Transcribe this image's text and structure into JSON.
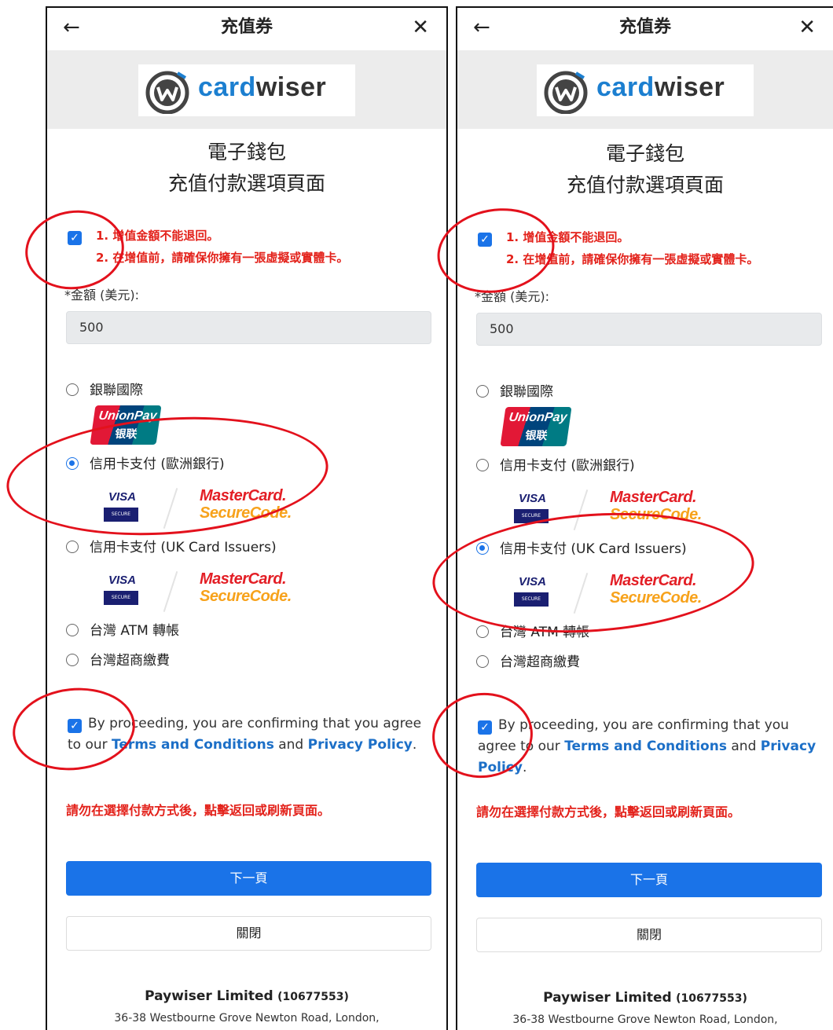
{
  "panels": [
    {
      "header": {
        "title": "充值券",
        "back_icon": "←",
        "close_icon": "✕"
      },
      "brand": {
        "word_part1": "card",
        "word_part2": "wiser"
      },
      "heading": {
        "line1": "電子錢包",
        "line2": "充值付款選項頁面"
      },
      "warnings": {
        "line1": "1. 增值金額不能退回。",
        "line2": "2. 在增值前，請確保你擁有一張虛擬或實體卡。",
        "checked": true
      },
      "amount": {
        "label": "*金額 (美元):",
        "value": "500"
      },
      "payment_options": [
        {
          "label": "銀聯國際",
          "logo": "unionpay",
          "selected": false
        },
        {
          "label": "信用卡支付 (歐洲銀行)",
          "logo": "visa-mastercard",
          "selected": true
        },
        {
          "label": "信用卡支付 (UK Card Issuers)",
          "logo": "visa-mastercard",
          "selected": false
        },
        {
          "label": "台灣 ATM 轉帳",
          "selected": false
        },
        {
          "label": "台灣超商繳費",
          "selected": false
        }
      ],
      "agreement": {
        "checked": true,
        "prefix": "By proceeding, you are confirming that you agree to our ",
        "terms": "Terms and Conditions",
        "and": " and ",
        "privacy": "Privacy Policy",
        "suffix": "."
      },
      "notice": "請勿在選擇付款方式後，點擊返回或刷新頁面。",
      "buttons": {
        "next": "下一頁",
        "close": "關閉"
      },
      "footer": {
        "company": "Paywiser Limited",
        "company_no": "(10677553)",
        "address": "36-38 Westbourne Grove Newton Road, London,"
      }
    },
    {
      "header": {
        "title": "充值券",
        "back_icon": "←",
        "close_icon": "✕"
      },
      "brand": {
        "word_part1": "card",
        "word_part2": "wiser"
      },
      "heading": {
        "line1": "電子錢包",
        "line2": "充值付款選項頁面"
      },
      "warnings": {
        "line1": "1. 增值金額不能退回。",
        "line2": "2. 在增值前，請確保你擁有一張虛擬或實體卡。",
        "checked": true
      },
      "amount": {
        "label": "*金額 (美元):",
        "value": "500"
      },
      "payment_options": [
        {
          "label": "銀聯國際",
          "logo": "unionpay",
          "selected": false
        },
        {
          "label": "信用卡支付 (歐洲銀行)",
          "logo": "visa-mastercard",
          "selected": false
        },
        {
          "label": "信用卡支付 (UK Card Issuers)",
          "logo": "visa-mastercard",
          "selected": true
        },
        {
          "label": "台灣 ATM 轉帳",
          "selected": false
        },
        {
          "label": "台灣超商繳費",
          "selected": false
        }
      ],
      "agreement": {
        "checked": true,
        "prefix": "By proceeding, you are confirming that you agree to our ",
        "terms": "Terms and Conditions",
        "and": " and ",
        "privacy": "Privacy Policy",
        "suffix": "."
      },
      "notice": "請勿在選擇付款方式後，點擊返回或刷新頁面。",
      "buttons": {
        "next": "下一頁",
        "close": "關閉"
      },
      "footer": {
        "company": "Paywiser Limited",
        "company_no": "(10677553)",
        "address": "36-38 Westbourne Grove Newton Road, London,"
      }
    }
  ],
  "card_logos": {
    "unionpay_line1": "UnionPay",
    "unionpay_line2": "银联",
    "visa": "VISA",
    "visa_badge": "SECURE",
    "mastercard_line1": "MasterCard.",
    "mastercard_line2": "SecureCode."
  },
  "colors": {
    "primary": "#1a73e8",
    "warning": "#e3221b",
    "link": "#1c6fc7",
    "annotation": "#e3111c"
  }
}
